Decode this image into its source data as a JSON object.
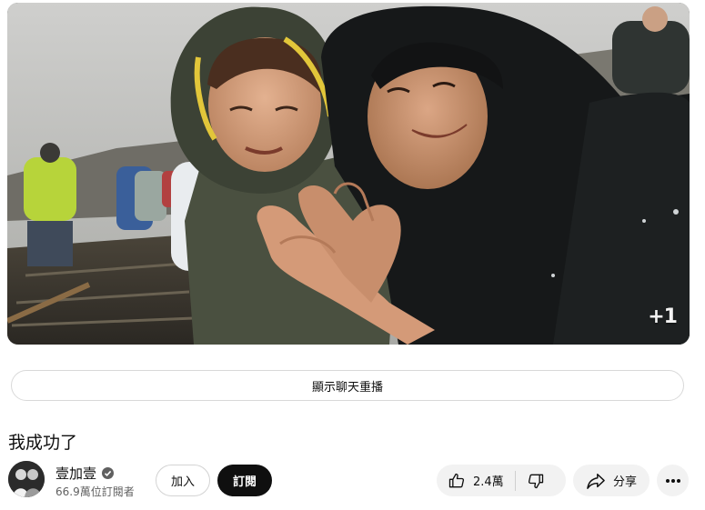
{
  "player": {
    "watermark": "+1",
    "description": "video-frame"
  },
  "chat_replay": {
    "label": "顯示聊天重播"
  },
  "video": {
    "title": "我成功了"
  },
  "channel": {
    "name": "壹加壹",
    "subscribers": "66.9萬位訂閱者",
    "verified": true
  },
  "buttons": {
    "join": "加入",
    "subscribe": "訂閱",
    "like_count": "2.4萬",
    "share": "分享"
  },
  "icons": {
    "like": "thumbs-up-icon",
    "dislike": "thumbs-down-icon",
    "share": "share-arrow-icon",
    "more": "more-horizontal-icon",
    "verified": "verified-check-icon"
  },
  "colors": {
    "subscribe_bg": "#0f0f0f",
    "pill_bg": "#f2f2f2",
    "secondary_text": "#606060"
  }
}
